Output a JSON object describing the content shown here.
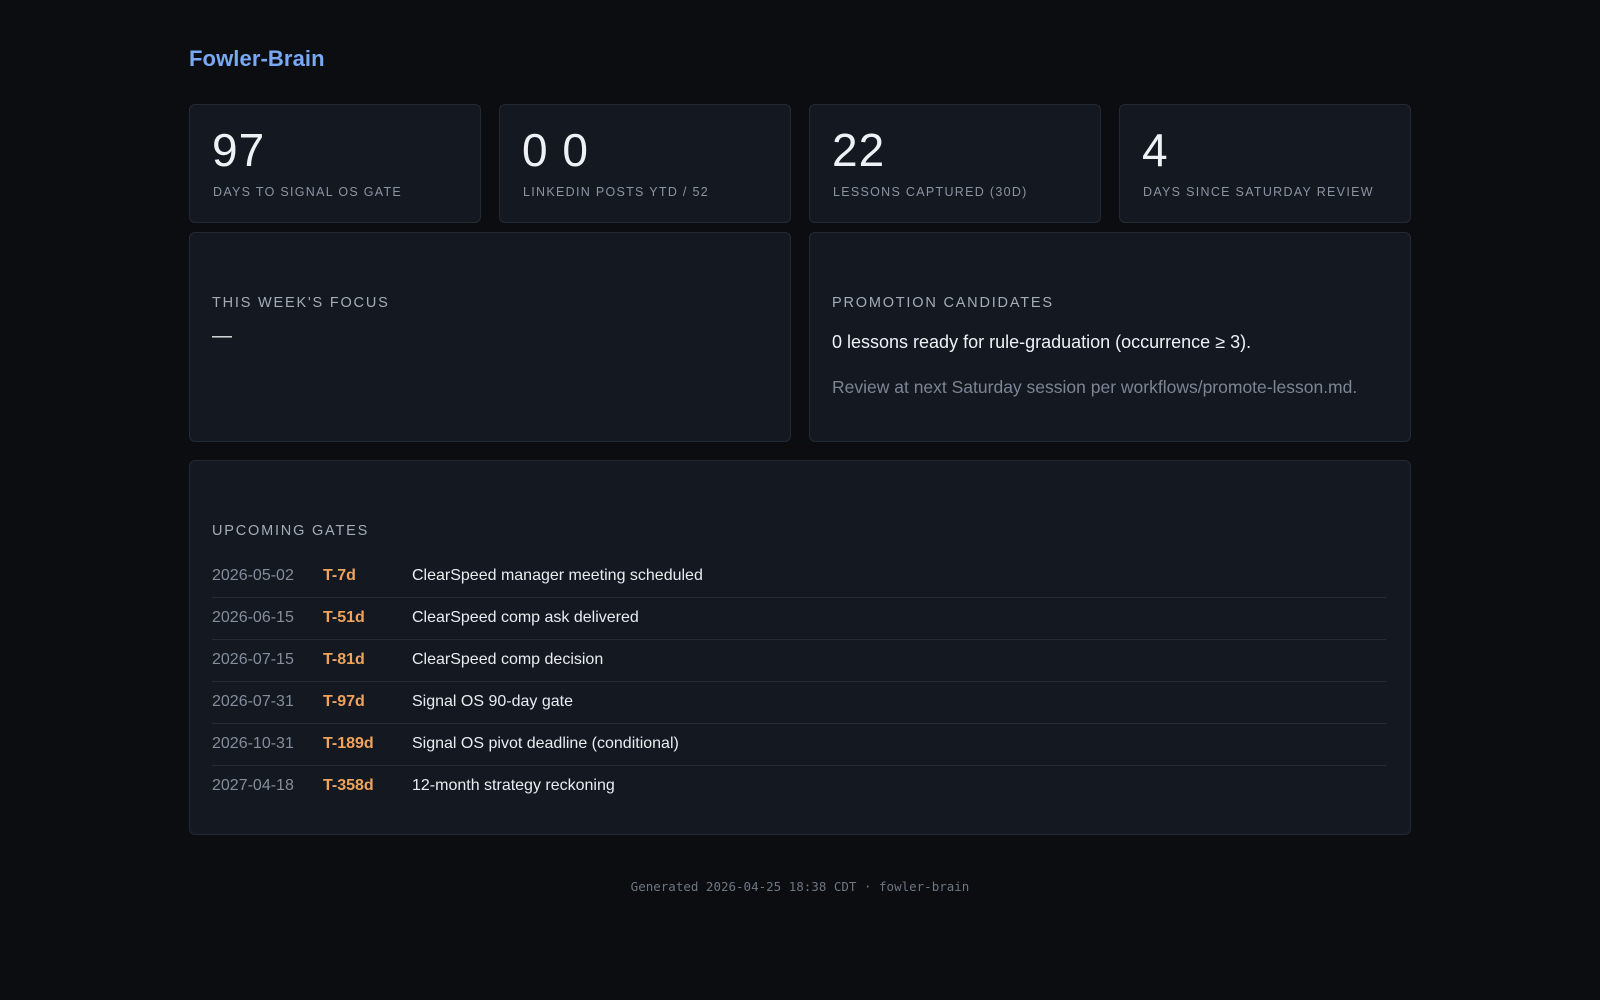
{
  "app": {
    "title": "Fowler-Brain"
  },
  "stats": [
    {
      "value": "97",
      "label": "DAYS TO SIGNAL OS GATE"
    },
    {
      "value": "0 0",
      "label": "LINKEDIN POSTS YTD / 52"
    },
    {
      "value": "22",
      "label": "LESSONS CAPTURED (30D)"
    },
    {
      "value": "4",
      "label": "DAYS SINCE SATURDAY REVIEW"
    }
  ],
  "focus": {
    "title": "THIS WEEK'S FOCUS",
    "value": "—"
  },
  "promotion": {
    "title": "PROMOTION CANDIDATES",
    "main": "0 lessons ready for rule-graduation (occurrence ≥ 3).",
    "sub": "Review at next Saturday session per workflows/promote-lesson.md."
  },
  "gates": {
    "title": "UPCOMING GATES",
    "items": [
      {
        "date": "2026-05-02",
        "t": "T-7d",
        "desc": "ClearSpeed manager meeting scheduled"
      },
      {
        "date": "2026-06-15",
        "t": "T-51d",
        "desc": "ClearSpeed comp ask delivered"
      },
      {
        "date": "2026-07-15",
        "t": "T-81d",
        "desc": "ClearSpeed comp decision"
      },
      {
        "date": "2026-07-31",
        "t": "T-97d",
        "desc": "Signal OS 90-day gate"
      },
      {
        "date": "2026-10-31",
        "t": "T-189d",
        "desc": "Signal OS pivot deadline (conditional)"
      },
      {
        "date": "2027-04-18",
        "t": "T-358d",
        "desc": "12-month strategy reckoning"
      }
    ]
  },
  "footer": {
    "text": "Generated 2026-04-25 18:38 CDT · fowler-brain"
  },
  "colors": {
    "background": "#0b0d11",
    "card": "#141921",
    "brand": "#79a9f5",
    "countdown": "#f0a35a"
  }
}
